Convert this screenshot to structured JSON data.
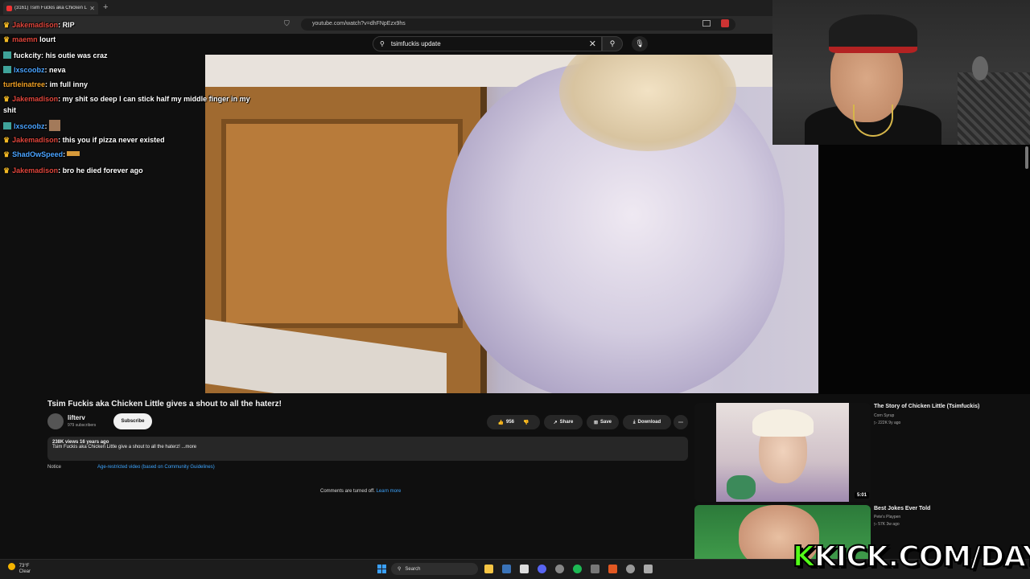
{
  "browser": {
    "tab_title": "(3161) Tsim Fuckis aka Chicken Little",
    "url": "youtube.com/watch?v=dhFNpEzx9hs"
  },
  "search": {
    "query": "tsimfuckis update"
  },
  "chat": [
    {
      "user": "Jakemadison",
      "text": ": RIP",
      "user_color": "#e0463c",
      "badge": "crown"
    },
    {
      "user": "maemn",
      "text": " lourt",
      "user_color": "#e0463c",
      "badge": "crown"
    },
    {
      "user": "fuckcity",
      "text": ": his outie was craz",
      "user_color": "#ffffff",
      "badge": "sub"
    },
    {
      "user": "lxscoobz",
      "text": ": neva",
      "user_color": "#4aa3ff",
      "badge": "sub"
    },
    {
      "user": "turtleinatree",
      "text": ": im full inny",
      "user_color": "#f0a024",
      "badge": "none"
    },
    {
      "user": "Jakemadison",
      "text": ": my shit so deep I can stick half my middle finger in my",
      "user_color": "#e0463c",
      "badge": "crown"
    },
    {
      "user": "",
      "text": "shit",
      "user_color": "#ffffff",
      "badge": "none"
    },
    {
      "user": "lxscoobz",
      "text": ":",
      "user_color": "#4aa3ff",
      "badge": "sub"
    },
    {
      "user": "Jakemadison",
      "text": ": this you if pizza never existed",
      "user_color": "#e0463c",
      "badge": "crown"
    },
    {
      "user": "ShadOwSpeed",
      "text": ":",
      "user_color": "#4aa3ff",
      "badge": "crown"
    },
    {
      "user": "Jakemadison",
      "text": ": bro he died forever ago",
      "user_color": "#e0463c",
      "badge": "crown"
    }
  ],
  "video": {
    "title": "Tsim Fuckis aka Chicken Little gives a shout to all the haterz!",
    "channel": "lifterv",
    "subscribers": "979 subscribers",
    "subscribe_label": "Subscribe",
    "likes": "956",
    "share_label": "Share",
    "save_label": "Save",
    "download_label": "Download",
    "views_date": "238K views  16 years ago",
    "description": "Tsim Fuckis aka Chicken Little give a shout to all the haterz! ...more",
    "notice_label": "Notice",
    "notice_link": "Age-restricted video (based on Community Guidelines)",
    "comments_off": "Comments are turned off.",
    "learn_more": "Learn more"
  },
  "recommended": [
    {
      "title": "The Story of Chicken Little (Tsimfuckis)",
      "channel": "Corn Syrup",
      "meta": "▷ 222K  9y ago",
      "duration": "5:01"
    },
    {
      "title": "Best Jokes Ever Told",
      "channel": "Pete's Playpen",
      "meta": "▷ 57K  3w ago"
    }
  ],
  "overlay": {
    "kick_k": "K",
    "kick_rest": "KICK.COM/DAYS"
  },
  "taskbar": {
    "temp": "73°F",
    "weather": "Clear",
    "search_label": "Search"
  },
  "colors": {
    "link": "#3ea6ff",
    "kick_green": "#53fc18",
    "crown": "#f2b824"
  }
}
